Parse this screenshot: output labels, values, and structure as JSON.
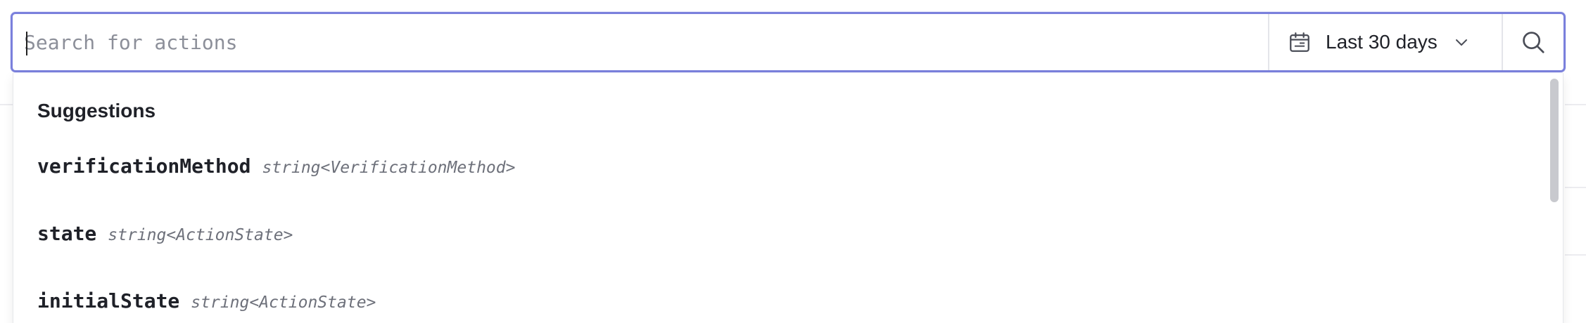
{
  "search": {
    "placeholder": "Search for actions",
    "value": ""
  },
  "date_range": {
    "label": "Last 30 days",
    "icon": "calendar-icon"
  },
  "search_button": {
    "icon": "search-icon"
  },
  "dropdown": {
    "heading": "Suggestions",
    "items": [
      {
        "name": "verificationMethod",
        "type": "string<VerificationMethod>"
      },
      {
        "name": "state",
        "type": "string<ActionState>"
      },
      {
        "name": "initialState",
        "type": "string<ActionState>"
      }
    ]
  },
  "colors": {
    "focus_border": "#7a80dc",
    "text": "#1f2128",
    "muted": "#6d707a"
  }
}
